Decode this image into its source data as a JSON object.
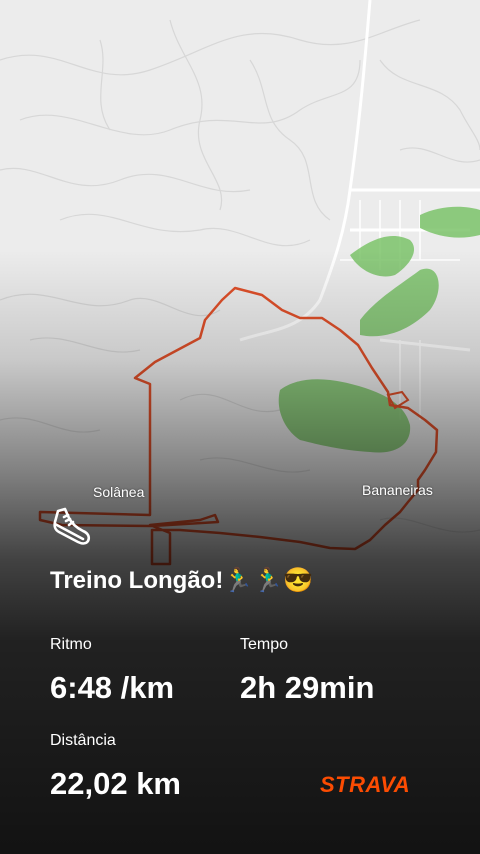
{
  "map": {
    "places": [
      "Solânea",
      "Bananeiras"
    ]
  },
  "activity": {
    "title": "Treino Longão!🏃‍♂️🏃‍♂️😎",
    "icon": "running-shoe-icon"
  },
  "stats": {
    "pace_label": "Ritmo",
    "pace_value": "6:48 /km",
    "time_label": "Tempo",
    "time_value": "2h 29min",
    "distance_label": "Distância",
    "distance_value": "22,02 km"
  },
  "brand": {
    "name": "STRAVA",
    "color": "#fc4c02"
  },
  "colors": {
    "route": "#e0502a",
    "park": "#7cc46a"
  }
}
